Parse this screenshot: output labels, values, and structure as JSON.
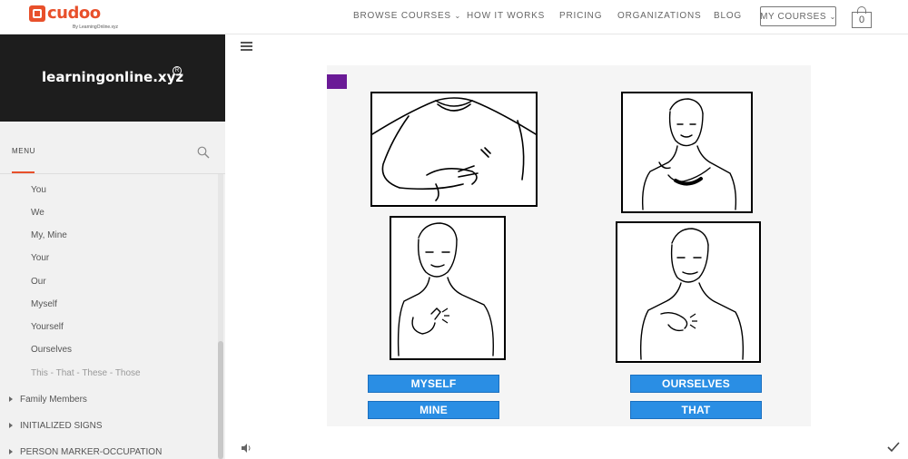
{
  "header": {
    "logo_text": "cudoo",
    "logo_sub": "By LearningOnline.xyz",
    "nav": [
      "BROWSE COURSES",
      "HOW IT WORKS",
      "PRICING",
      "ORGANIZATIONS",
      "BLOG"
    ],
    "my_courses": "MY COURSES",
    "cart_count": "0"
  },
  "sidebar": {
    "brand": "learningonline.xyz",
    "menu_label": "MENU",
    "items": [
      "You",
      "We",
      "My, Mine",
      "Your",
      "Our",
      "Myself",
      "Yourself",
      "Ourselves",
      "This - That - These - Those"
    ],
    "groups": [
      "Family Members",
      "INITIALIZED SIGNS",
      "PERSON MARKER-OCCUPATION"
    ]
  },
  "slide": {
    "labels": [
      "MYSELF",
      "OURSELVES",
      "MINE",
      "THAT"
    ],
    "accent": "#2a8ee4",
    "marker_color": "#6a1a96"
  }
}
